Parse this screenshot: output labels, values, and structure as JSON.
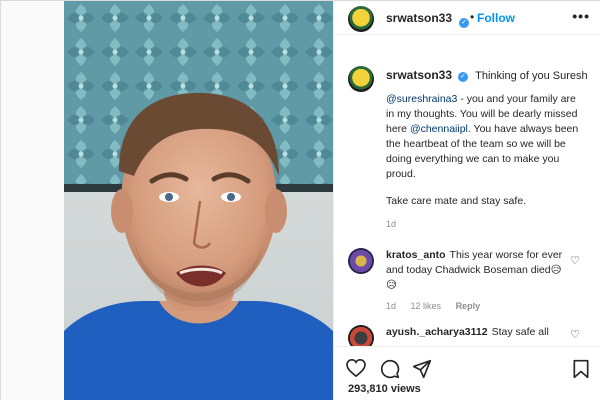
{
  "post": {
    "username": "srwatson33",
    "follow_label": "Follow",
    "separator": "•",
    "more_label": "•••"
  },
  "caption": {
    "username": "srwatson33",
    "first_line": "Thinking of you Suresh",
    "mention1": "@sureshraina3",
    "text1": " - you and your family are in my thoughts. You will be dearly missed here ",
    "mention2": "@chennaiipl",
    "text2": ". You have always been the heartbeat of the team so we will be doing everything we can to make you proud.",
    "paragraph2": "Take care mate and stay safe.",
    "time": "1d"
  },
  "comments": [
    {
      "username": "kratos_anto",
      "text": "This year worse for ever and today Chadwick Boseman died😥😥",
      "time": "1d",
      "likes": "12 likes",
      "reply_label": "Reply"
    },
    {
      "username": "ayush._acharya3112",
      "text": "Stay safe all"
    }
  ],
  "footer": {
    "views_count": "293,810",
    "views_label": "views"
  },
  "icons": {
    "verified": "verified-badge-icon",
    "like": "heart-icon",
    "comment": "comment-icon",
    "share": "share-icon",
    "save": "bookmark-icon"
  },
  "colors": {
    "link": "#0095f6",
    "mention": "#00376b",
    "muted": "#8e8e8e",
    "verified": "#3897f0"
  }
}
